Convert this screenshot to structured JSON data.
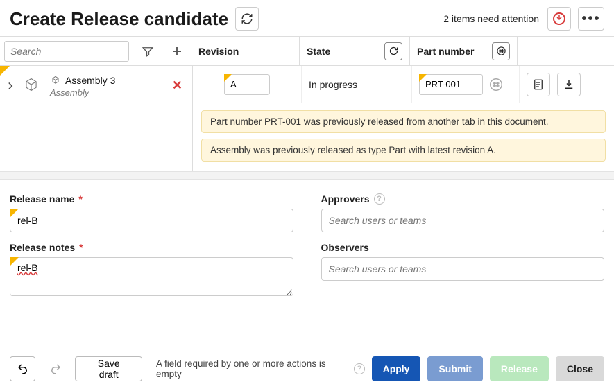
{
  "title": "Create Release candidate",
  "attention_text": "2 items need attention",
  "toolbar": {
    "search_placeholder": "Search",
    "headers": {
      "revision": "Revision",
      "state": "State",
      "part_number": "Part number"
    }
  },
  "tree": {
    "item_name": "Assembly 3",
    "item_type": "Assembly"
  },
  "row": {
    "revision": "A",
    "state": "In progress",
    "part_number": "PRT-001"
  },
  "warnings": [
    "Part number PRT-001 was previously released from another tab in this document.",
    "Assembly was previously released as type Part with latest revision A."
  ],
  "form": {
    "release_name_label": "Release name",
    "release_name_value": "rel-B",
    "release_notes_label": "Release notes",
    "release_notes_value": "rel-B",
    "approvers_label": "Approvers",
    "approvers_placeholder": "Search users or teams",
    "observers_label": "Observers",
    "observers_placeholder": "Search users or teams"
  },
  "footer": {
    "save_draft": "Save draft",
    "validation_msg": "A field required by one or more actions is empty",
    "apply": "Apply",
    "submit": "Submit",
    "release": "Release",
    "close": "Close"
  }
}
